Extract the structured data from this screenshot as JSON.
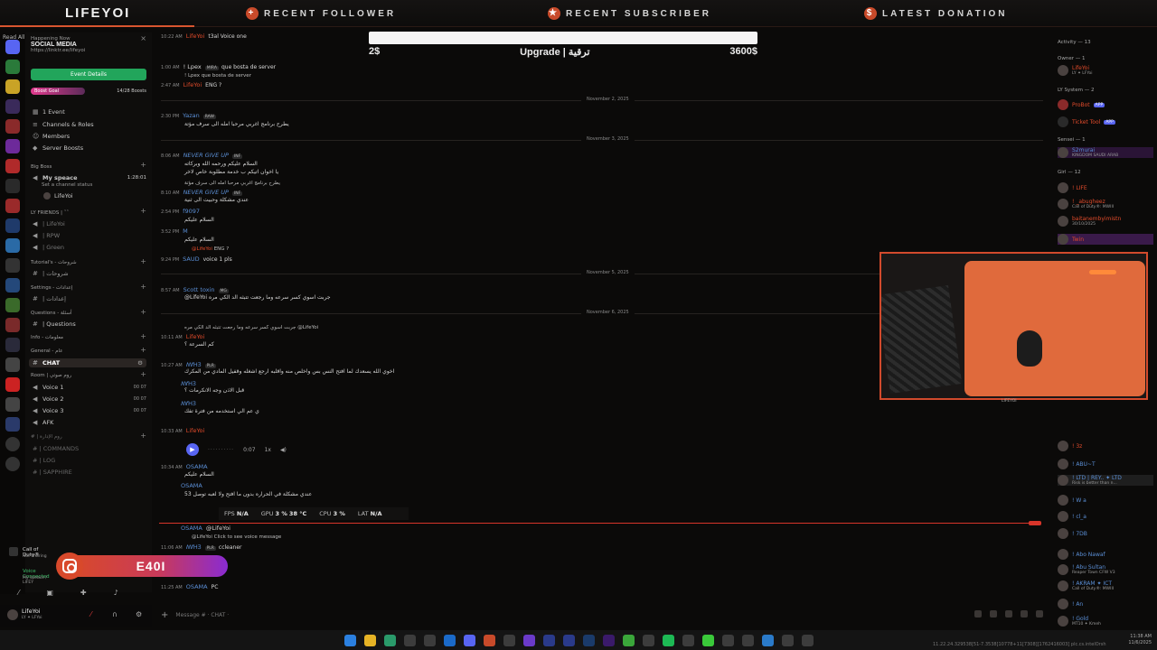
{
  "overlay": {
    "logo": "LIFEYOI",
    "recent_follower": "RECENT FOLLOWER",
    "recent_subscriber": "RECENT SUBSCRIBER",
    "latest_donation": "LATEST DONATION",
    "upgrade_title": "Upgrade | ترقية",
    "upgrade_min": "2$",
    "upgrade_max": "3600$",
    "instagram_handle": "E40I",
    "accent": "#d8552f"
  },
  "sidebar": {
    "read_all": "Read All",
    "happening_now": "Happening Now",
    "server_name": "SOCIAL MEDIA",
    "server_link": "https://linktr.ee/lifeyoi",
    "event_button": "Event Details",
    "boost_goal": "Boost Goal",
    "boost_count": "14/28 Boosts",
    "items": [
      {
        "label": "1 Event"
      },
      {
        "label": "Channels & Roles"
      },
      {
        "label": "Members"
      },
      {
        "label": "Server Boosts"
      }
    ],
    "big_boss_cat": "Big Boss",
    "my_space": "My speace",
    "set_status": "Set a channel status",
    "space_time": "1:28:01",
    "space_user": "LifeYoi",
    "friends_cat": "LY FRIENDS | ˜˜",
    "friends": [
      "| LifeYoi",
      "| RPW",
      "| Green"
    ],
    "tutorials_cat": "Tutorial's - شروحات",
    "tutorials_ch": "| شروحات",
    "settings_cat": "Settings - إعدادات",
    "settings_ch": "| إعدادات",
    "questions_cat": "Questions - أسئلة",
    "questions_ch": "| Questions",
    "info_cat": "Info - معلومات",
    "general_cat": "General - عام",
    "chat_ch": "CHAT",
    "room_cat": "Room | روم صوتي",
    "voices": [
      {
        "label": "Voice 1",
        "count": "00 07"
      },
      {
        "label": "Voice 2",
        "count": "00 07"
      },
      {
        "label": "Voice 3",
        "count": "00 07"
      },
      {
        "label": "AFK",
        "count": ""
      }
    ],
    "log_cat": "# | روم الإدارة",
    "log_channels": [
      "# | COMMANDS",
      "# | LOG",
      "# | SAPPHIRE"
    ],
    "activity_game": "Call of Duty®",
    "activity_sub": "Not Sharing",
    "voice_connected": "Voice Connected",
    "voice_where": "My speace / LIFEY",
    "user_name": "LifeYoi",
    "user_tag": "LY ✦ LFYoi"
  },
  "chat": {
    "messages": [
      {
        "time": "10:22 AM",
        "name": "LifeYoi",
        "text": "t3al Voice one",
        "color": "red"
      },
      {
        "time": "1:00 AM",
        "name": "! Lpex",
        "text": "que bosta de server",
        "color": "txt"
      },
      {
        "time": "",
        "name": "! Lpex",
        "text": "que bosta de server",
        "color": "sub"
      },
      {
        "time": "2:47 AM",
        "name": "LifeYoi",
        "text": "ENG ?",
        "color": "red"
      },
      {
        "time": "2:30 PM",
        "name": "Yazan",
        "text": "يطرح برنامج اغربي مرحبا امله الى سرف مؤتة",
        "color": "blue"
      },
      {
        "time": "8:06 AM",
        "name": "NEVER GIVE UP",
        "text": "السلام عليكم ورحمه الله وبركاته",
        "color": "blue"
      },
      {
        "time": "",
        "name": "",
        "text": "يا اخوان اتيكم ب خدمة مطلوبة خاص لاخر",
        "color": "sub"
      },
      {
        "time": "",
        "name": "",
        "text": "يطرح برنامج اغربي مرحبا امله الى سرف مؤتة",
        "color": "sub"
      },
      {
        "time": "8:10 AM",
        "name": "NEVER GIVE UP",
        "text": "عندي مشكلة وحبيت الى ثنية",
        "color": "blue"
      },
      {
        "time": "2:54 PM",
        "name": "f9097",
        "text": "السلام عليكم",
        "color": "blue"
      },
      {
        "time": "3:52 PM",
        "name": "M",
        "text": "السلام عليكم",
        "color": "blue"
      },
      {
        "time": "",
        "name": "@LifeYoi",
        "text": "ENG ?",
        "color": "red"
      },
      {
        "time": "9:24 PM",
        "name": "SAUD",
        "text": "voice 1 pls",
        "color": "blue"
      },
      {
        "time": "8:57 AM",
        "name": "Scott toxin",
        "text": "@LifeYoi جربت اسوي كسر سرعه وما رجعت تتبثه الد الكي مره",
        "color": "blue"
      },
      {
        "time": "10:11 AM",
        "name": "LifeYoi",
        "text": "كم السرعة ؟",
        "color": "red"
      },
      {
        "time": "10:27 AM",
        "name": "ꟿꞪꞫ",
        "text": "اخوي الله يسعدك لما افتح النس بس واخلص منه واقلبه ارجع اشغله وقفيل المادي من المكرك",
        "color": "blue"
      },
      {
        "time": "",
        "name": "ꟿꞪꞫ",
        "text": "قبل الاذن وجه الانكرمات ؟",
        "color": "blue"
      },
      {
        "time": "",
        "name": "ꟿꞪꞫ",
        "text": "ي عم الي استخدمه من فترة تفك",
        "color": "blue"
      },
      {
        "time": "10:33 AM",
        "name": "LifeYoi",
        "text": "",
        "color": "red"
      },
      {
        "time": "10:34 AM",
        "name": "OSAMA",
        "text": "السلام عليكم",
        "color": "blue"
      },
      {
        "time": "",
        "name": "OSAMA",
        "text": "عندي مشكلة في الحراره بدون ما افتح ولا لعبه توصل 53",
        "color": "blue"
      },
      {
        "time": "",
        "name": "OSAMA",
        "text": "@LifeYoi",
        "color": "blue"
      },
      {
        "time": "11:06 AM",
        "name": "ꟿꞪꞫ",
        "text": "ccleaner",
        "color": "blue"
      },
      {
        "time": "11:25 AM",
        "name": "OSAMA",
        "text": "PC",
        "color": "blue"
      }
    ],
    "reply_voice": "@LifeYoi Click to see voice message",
    "dates": [
      "November 2, 2025",
      "November 3, 2025",
      "November 5, 2025",
      "November 6, 2025"
    ],
    "voice_time": "0:07",
    "voice_speed": "1x",
    "stats": {
      "fps_label": "FPS",
      "fps": "N/A",
      "gpu_label": "GPU",
      "gpu": "3 %",
      "gpu_temp": "38 °C",
      "cpu_label": "CPU",
      "cpu": "3 %",
      "lat_label": "LAT",
      "lat": "N/A"
    },
    "input_placeholder": "Message # · CHAT ·"
  },
  "members": {
    "activity": "Activity — 13",
    "owner_head": "Owner — 1",
    "owner": {
      "name": "LifeYoi",
      "sub": "LY ✦ LFYoi"
    },
    "system_head": "LY System — 2",
    "system": [
      {
        "name": "ProBot",
        "badge": "APP"
      },
      {
        "name": "Ticket Tool",
        "badge": "APP"
      }
    ],
    "sensei_head": "Sensei — 1",
    "sensei": {
      "name": "S2murai",
      "sub": "KINGDOM SAUDI ARAB"
    },
    "girl_head": "Girl — 12",
    "girls": [
      {
        "name": "! LIFE"
      },
      {
        "name": "! _abugheez",
        "sub": "Call of Duty®: MWIII"
      },
      {
        "name": "baitanembyimistn",
        "sub": "30/10/2025"
      },
      {
        "name": "Twin"
      },
      {
        "name": "! 3z"
      },
      {
        "name": "! ABU~T"
      },
      {
        "name": "! LTD | REY.. ✦ LTD",
        "sub": "Risk is better than n..."
      },
      {
        "name": "! W a"
      },
      {
        "name": "! cl_a"
      },
      {
        "name": "! 7DB"
      },
      {
        "name": "! Abo Nawaf"
      },
      {
        "name": "! Abu Sultan",
        "sub": "Reaper Town CFW V3"
      },
      {
        "name": "! AKRAM ✦ ICT",
        "sub": "Call of Duty®: MWIII"
      },
      {
        "name": "! An"
      },
      {
        "name": "! Gold",
        "sub": "MT10 ✦ Kmeh"
      }
    ],
    "cam_label": "LIFEYOI"
  },
  "taskbar": {
    "time": "11:38 AM",
    "date": "11/6/2025",
    "watermark": "11.22.24.329538[51-7.3538]10778+11[7308][1762416003] plc.cs.intelOrsh"
  }
}
